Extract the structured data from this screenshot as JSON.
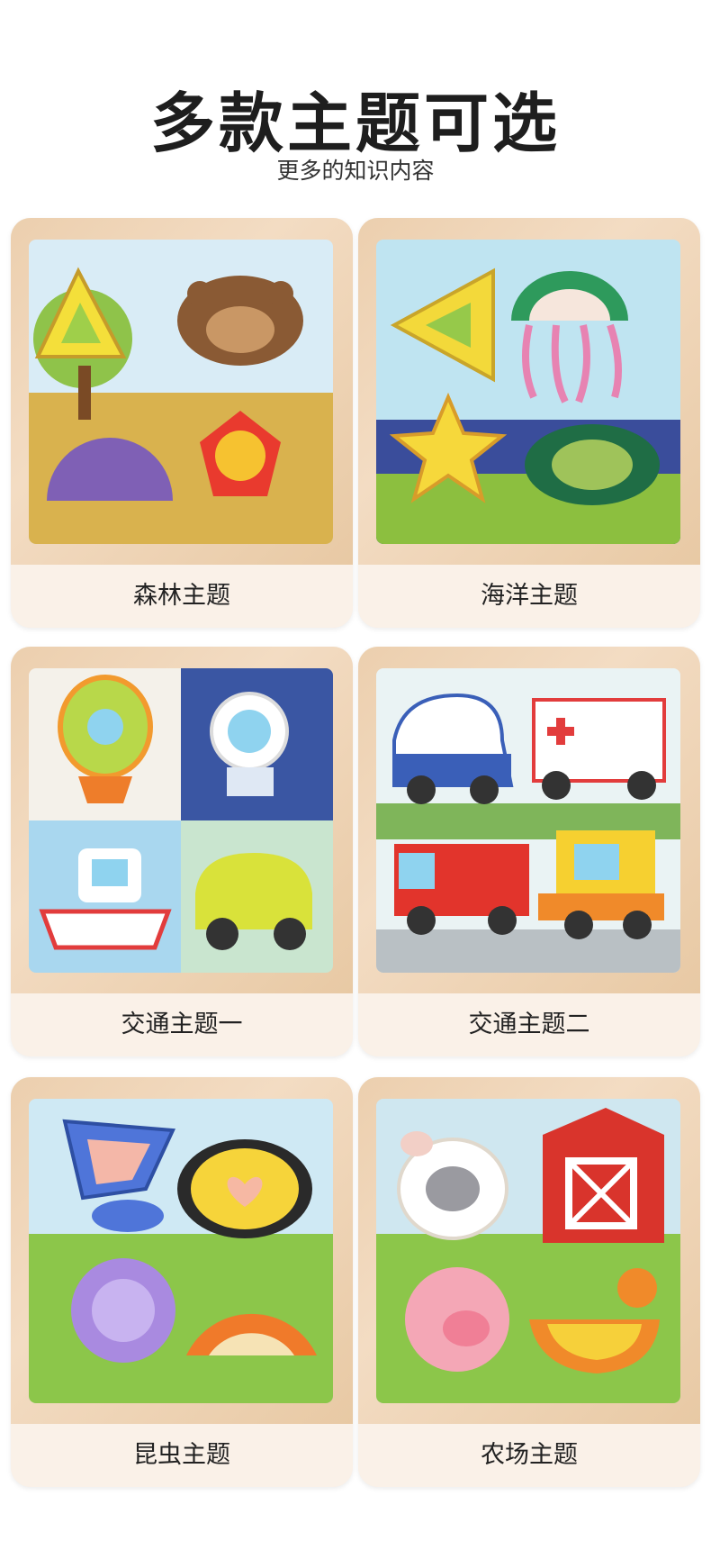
{
  "header": {
    "title": "多款主题可选",
    "subtitle": "更多的知识内容"
  },
  "themes": [
    {
      "label": "森林主题"
    },
    {
      "label": "海洋主题"
    },
    {
      "label": "交通主题一"
    },
    {
      "label": "交通主题二"
    },
    {
      "label": "昆虫主题"
    },
    {
      "label": "农场主题"
    }
  ]
}
